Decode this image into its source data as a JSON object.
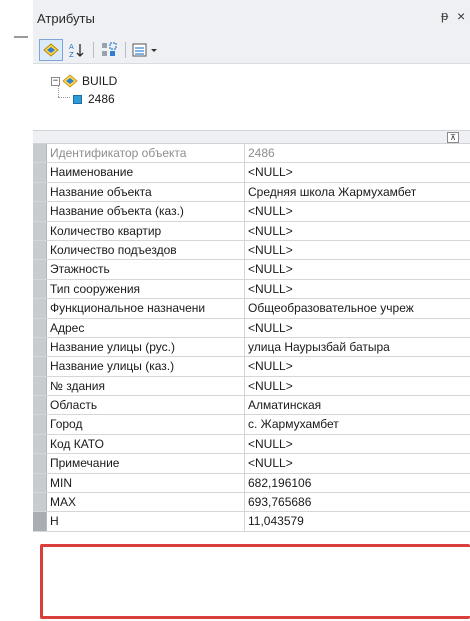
{
  "window": {
    "title": "Атрибуты",
    "pin_glyph": "ᵽ",
    "close_glyph": "×"
  },
  "toolbar": {
    "icons": [
      "list-by-layer-icon",
      "sort-icon",
      "selection-options-icon",
      "options-menu-icon"
    ]
  },
  "tree": {
    "root_label": "BUILD",
    "child_label": "2486"
  },
  "grid": {
    "rows": [
      {
        "name": "Идентификатор объекта",
        "value": "2486",
        "readonly": true
      },
      {
        "name": "Наименование",
        "value": "<NULL>"
      },
      {
        "name": "Название объекта",
        "value": "Средняя школа Жармухамбет"
      },
      {
        "name": "Название объекта (каз.)",
        "value": "<NULL>"
      },
      {
        "name": "Количество квартир",
        "value": "<NULL>"
      },
      {
        "name": "Количество подъездов",
        "value": "<NULL>"
      },
      {
        "name": "Этажность",
        "value": "<NULL>"
      },
      {
        "name": "Тип сооружения",
        "value": "<NULL>"
      },
      {
        "name": "Функциональное назначени",
        "value": "Общеобразовательное учреж"
      },
      {
        "name": "Адрес",
        "value": "<NULL>"
      },
      {
        "name": "Название улицы (рус.)",
        "value": "улица Наурызбай батыра"
      },
      {
        "name": "Название улицы (каз.)",
        "value": "<NULL>"
      },
      {
        "name": "№ здания",
        "value": "<NULL>"
      },
      {
        "name": "Область",
        "value": "Алматинская"
      },
      {
        "name": "Город",
        "value": "с. Жармухамбет"
      },
      {
        "name": "Код КАТО",
        "value": "<NULL>"
      },
      {
        "name": "Примечание",
        "value": "<NULL>"
      },
      {
        "name": "MIN",
        "value": "682,196106"
      },
      {
        "name": "MAX",
        "value": "693,765686"
      },
      {
        "name": "H",
        "value": "11,043579",
        "selected": true
      }
    ]
  },
  "colors": {
    "highlight": "#d9403c",
    "toolbar_bg": "#eef0f3"
  }
}
